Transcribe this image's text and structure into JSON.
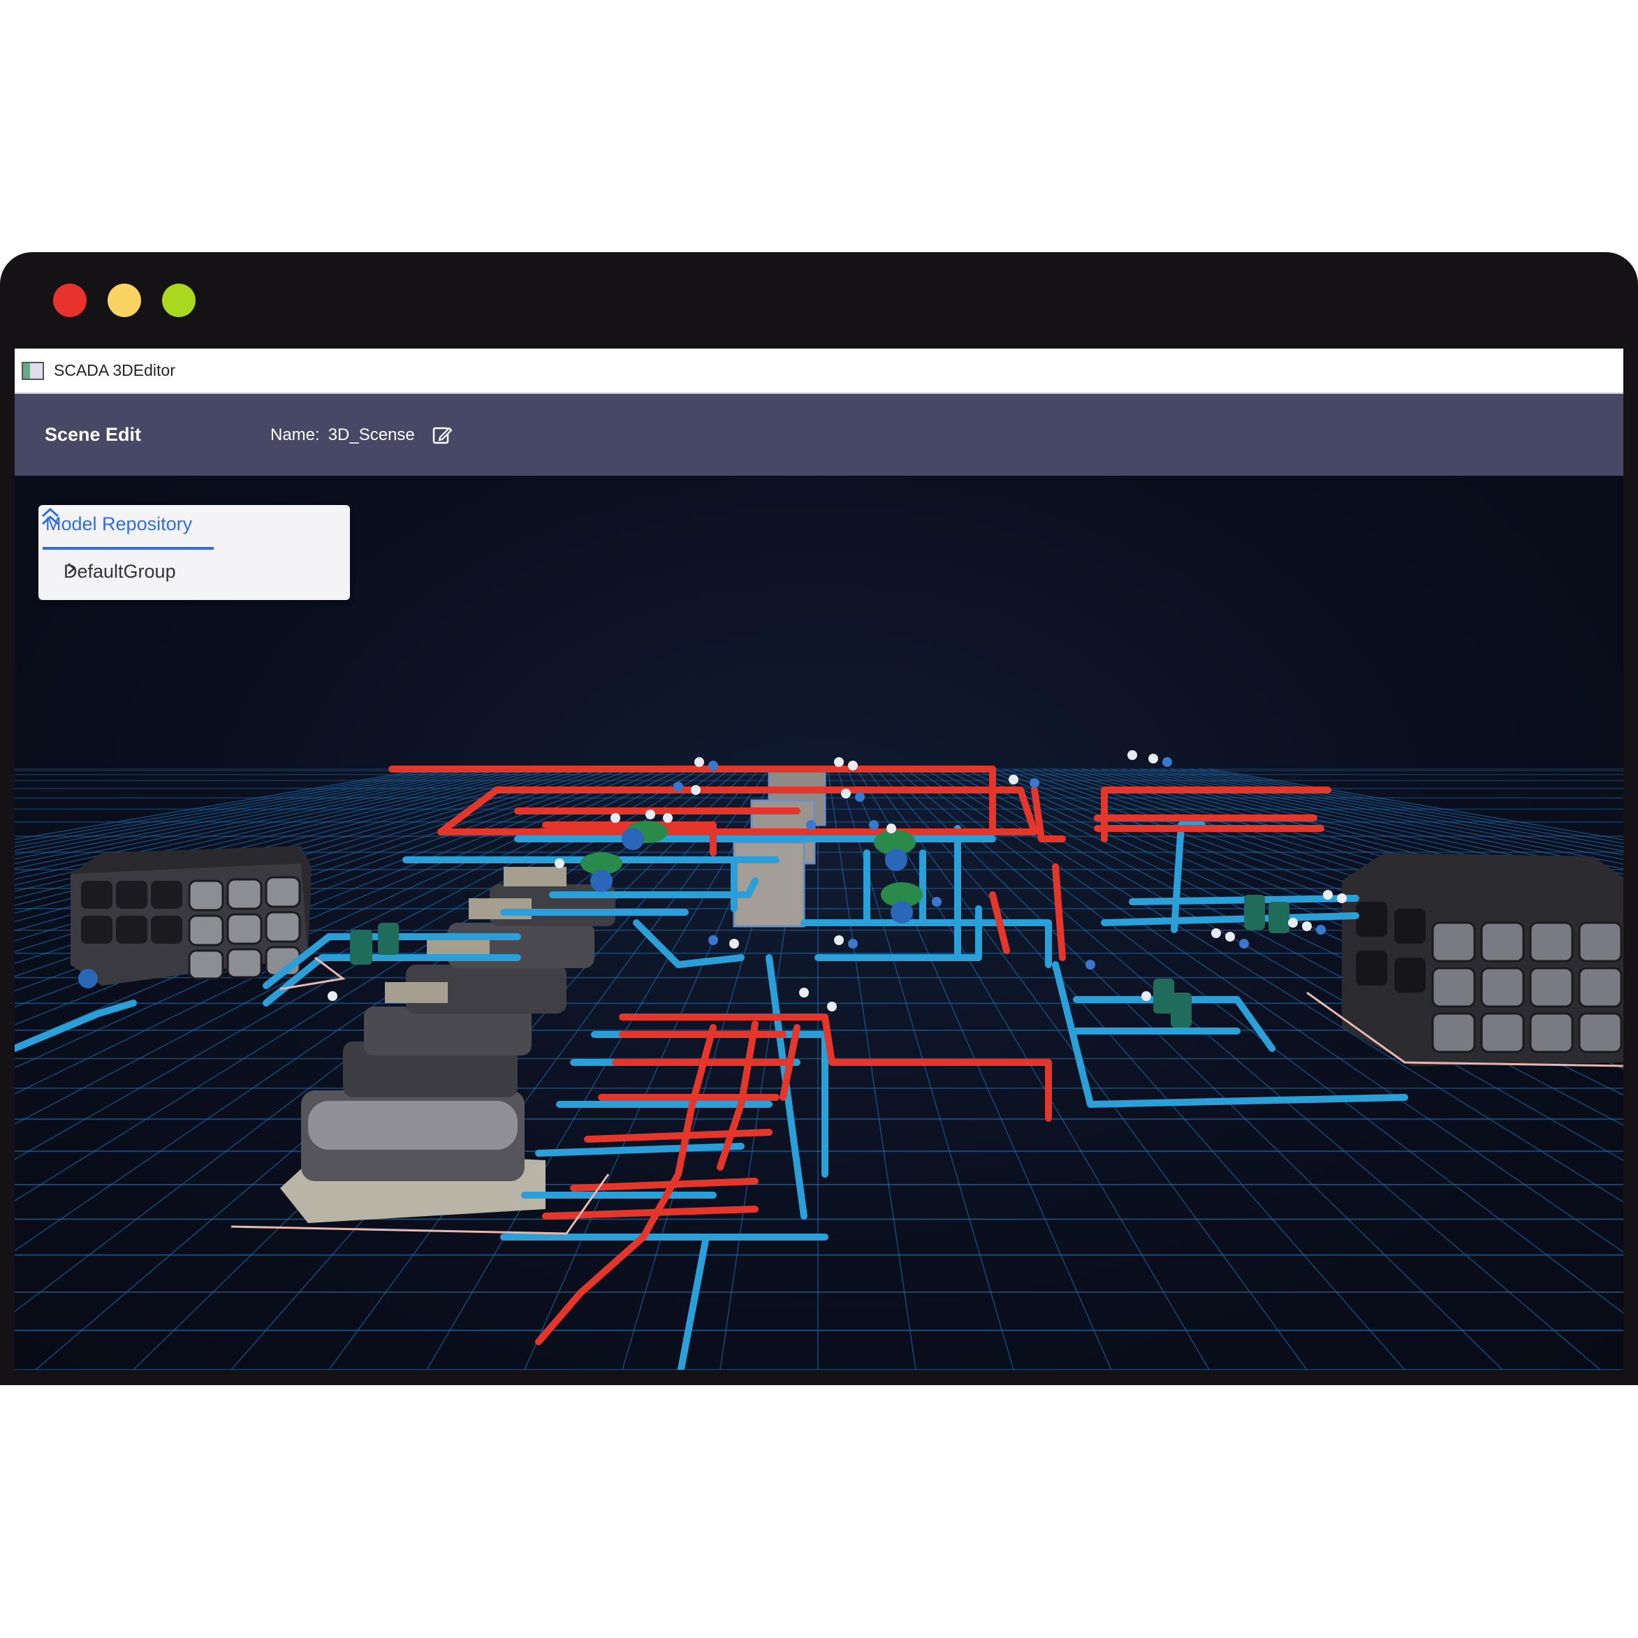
{
  "window_controls": {
    "close_color": "#e8322d",
    "minimize_color": "#f9d462",
    "maximize_color": "#a9d81f"
  },
  "app": {
    "title": "SCADA 3DEditor",
    "icon": "app-window-icon"
  },
  "toolbar": {
    "section_title": "Scene Edit",
    "name_label": "Name:",
    "name_value": "3D_Scense",
    "edit_icon": "edit-pencil-icon"
  },
  "model_repository": {
    "title": "Model Repository",
    "collapse_icon": "double-chevron-up-icon",
    "items": [
      {
        "label": "DefaultGroup",
        "icon": "chevron-right-icon"
      }
    ]
  },
  "scene": {
    "hot_pipe_color": "#e5362b",
    "cold_pipe_color": "#2a9fd8",
    "grid_color": "#1f6aa8"
  }
}
